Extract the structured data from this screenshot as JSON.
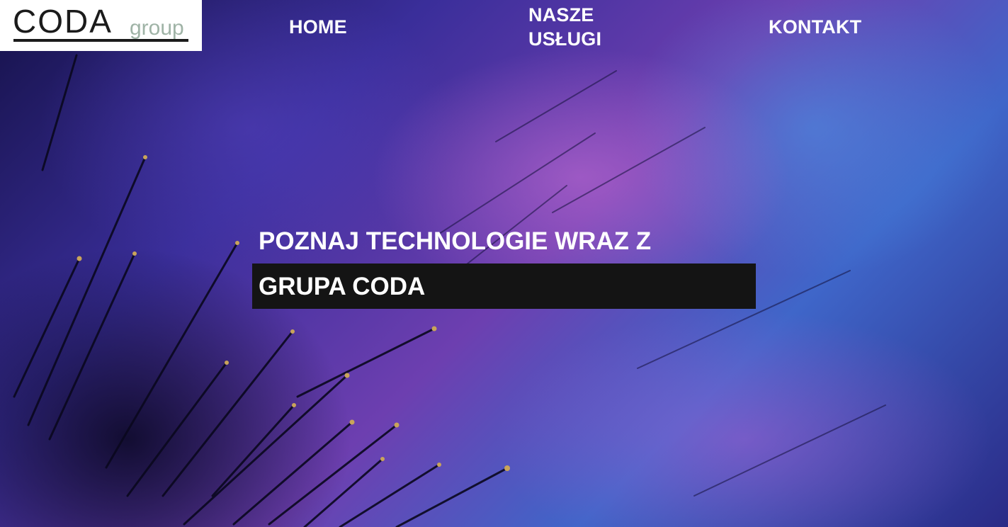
{
  "header": {
    "logo": {
      "primary_text": "CODA",
      "secondary_text": "group",
      "primary_color": "#1b1b1b",
      "secondary_color": "#9fb3a6"
    },
    "nav": [
      {
        "id": "home",
        "label": "HOME"
      },
      {
        "id": "services",
        "label": "NASZE USŁUGI"
      },
      {
        "id": "contact",
        "label": "KONTAKT"
      }
    ]
  },
  "hero": {
    "heading": "POZNAJ TECHNOLOGIE WRAZ Z",
    "highlight": "GRUPA CODA",
    "background_image": "purple-blue fiber optic strands"
  },
  "colors": {
    "text": "#ffffff",
    "highlight_bg": "#141414",
    "logo_bg": "#ffffff"
  }
}
